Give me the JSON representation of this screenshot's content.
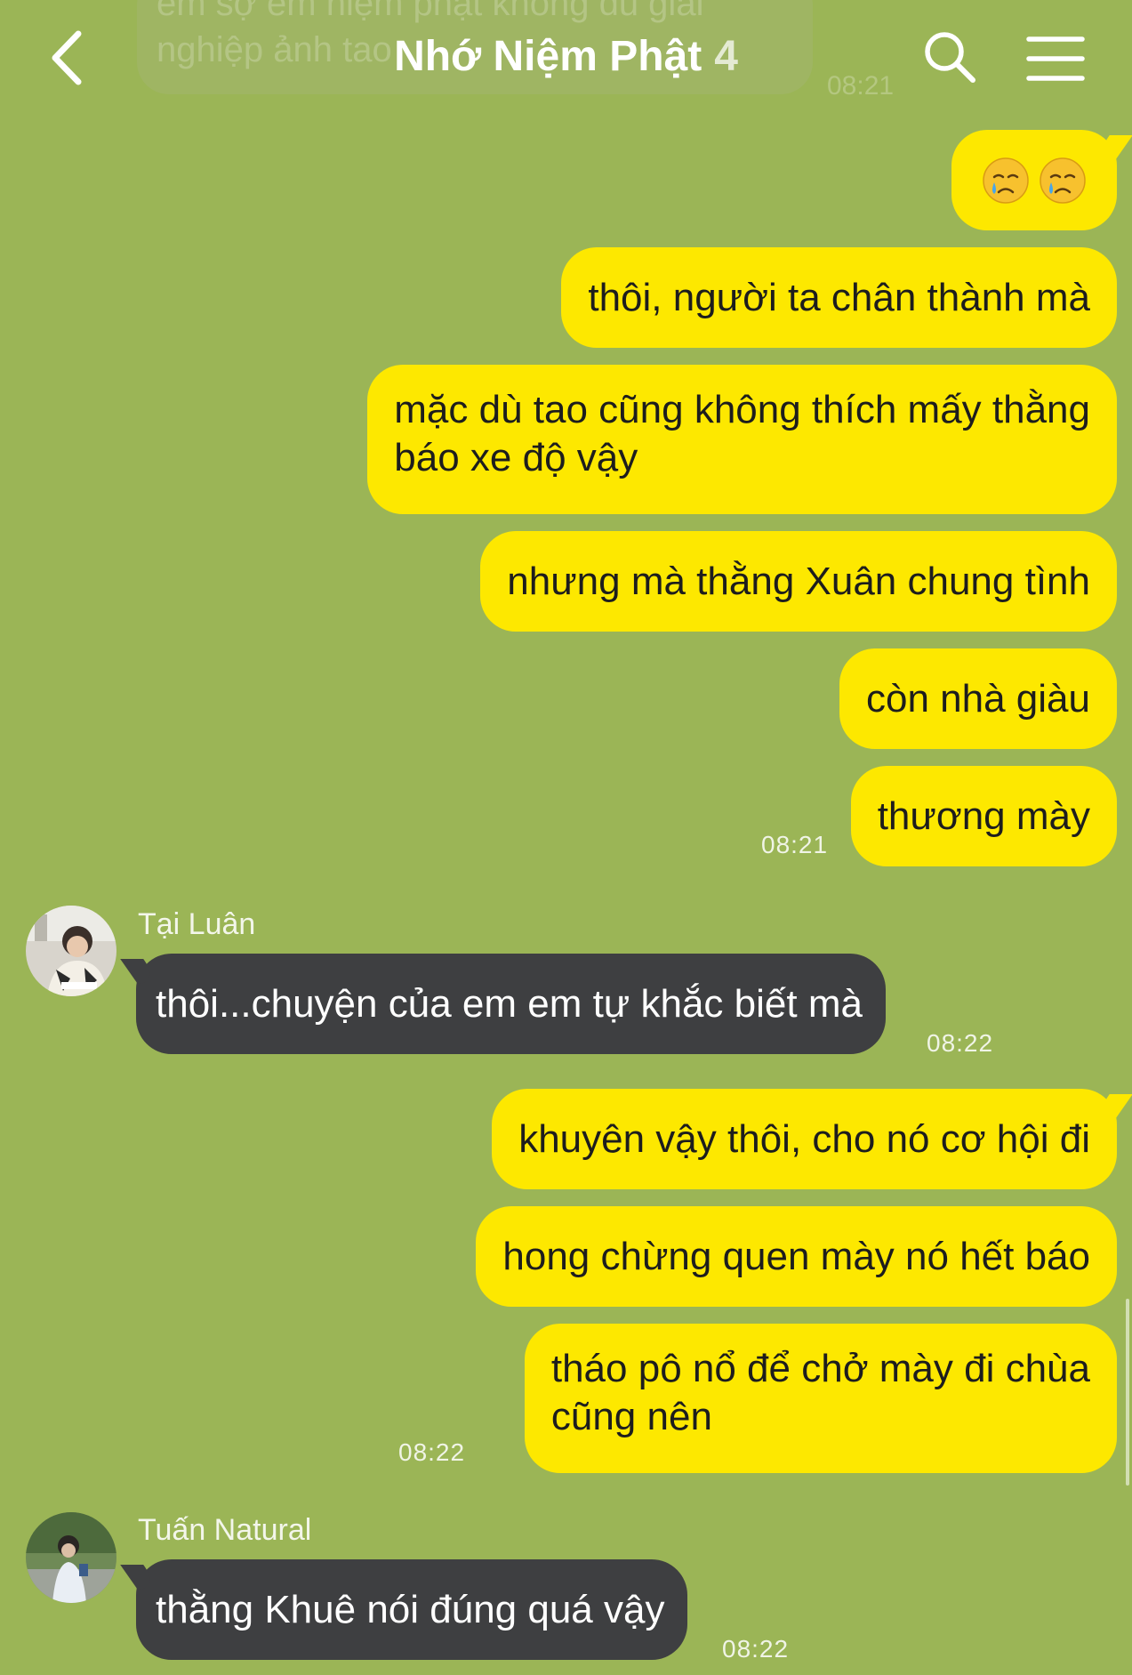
{
  "header": {
    "title": "Nhớ Niệm Phật",
    "member_count": "4",
    "previous_message_partial": "em sợ em niệm phật không đủ giải nghiệp ảnh tao",
    "previous_message_time": "08:21"
  },
  "messages": [
    {
      "sender": "me",
      "emoji": [
        "crying-face",
        "crying-face"
      ]
    },
    {
      "sender": "me",
      "text": "thôi, người ta chân thành mà"
    },
    {
      "sender": "me",
      "lines": [
        "mặc dù tao cũng không thích mấy thằng",
        "báo xe độ vậy"
      ]
    },
    {
      "sender": "me",
      "text": "nhưng mà thằng Xuân chung tình"
    },
    {
      "sender": "me",
      "text": "còn nhà giàu"
    },
    {
      "sender": "me",
      "text": "thương mày",
      "time": "08:21"
    },
    {
      "sender": "Tại Luân",
      "text": "thôi...chuyện của em em tự khắc biết mà",
      "time": "08:22"
    },
    {
      "sender": "me",
      "text": "khuyên vậy thôi, cho nó cơ hội đi"
    },
    {
      "sender": "me",
      "text": "hong chừng quen mày nó hết báo"
    },
    {
      "sender": "me",
      "lines": [
        "tháo pô nổ để chở mày đi chùa",
        "cũng nên"
      ],
      "time": "08:22"
    },
    {
      "sender": "Tuấn Natural",
      "text": "thằng Khuê nói đúng quá vậy",
      "time": "08:22"
    }
  ],
  "colors": {
    "background": "#9bb556",
    "my_bubble": "#fde800",
    "their_bubble": "#3e3f41"
  }
}
